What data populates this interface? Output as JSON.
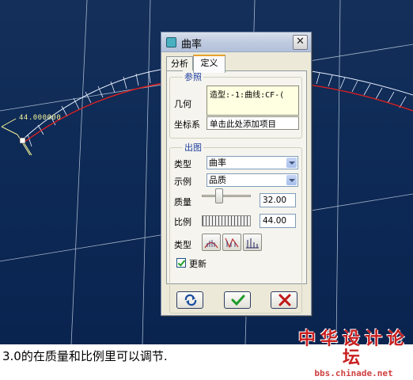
{
  "viewport": {
    "dimension_value": "44.000000"
  },
  "dialog": {
    "title": "曲率",
    "tabs": [
      {
        "label": "分析",
        "active": false
      },
      {
        "label": "定义",
        "active": true
      }
    ],
    "reference": {
      "legend": "参照",
      "geometry_label": "几何",
      "geometry_value": "造型:-1:曲线:CF-(",
      "csys_label": "坐标系",
      "csys_button": "单击此处添加项目"
    },
    "plot": {
      "legend": "出图",
      "type_label": "类型",
      "type_value": "曲率",
      "example_label": "示例",
      "example_value": "品质",
      "quality_label": "质量",
      "quality_value": "32.00",
      "quality_level": 0.32,
      "ratio_label": "比例",
      "ratio_value": "44.00",
      "style_label": "类型",
      "update_label": "更新",
      "update_checked": true
    }
  },
  "caption": "3.0的在质量和比例里可以调节.",
  "watermark": {
    "name": "中华设计论坛",
    "url": "bbs.chinade.net"
  },
  "colors": {
    "viewport_bg": "#0e2a56",
    "grid": "#c8d8e8",
    "curve": "#d82020",
    "comb": "#e8f0ff",
    "dimension": "#f2f29a",
    "ok_green": "#1f9a2a",
    "cancel_red": "#c01818"
  }
}
